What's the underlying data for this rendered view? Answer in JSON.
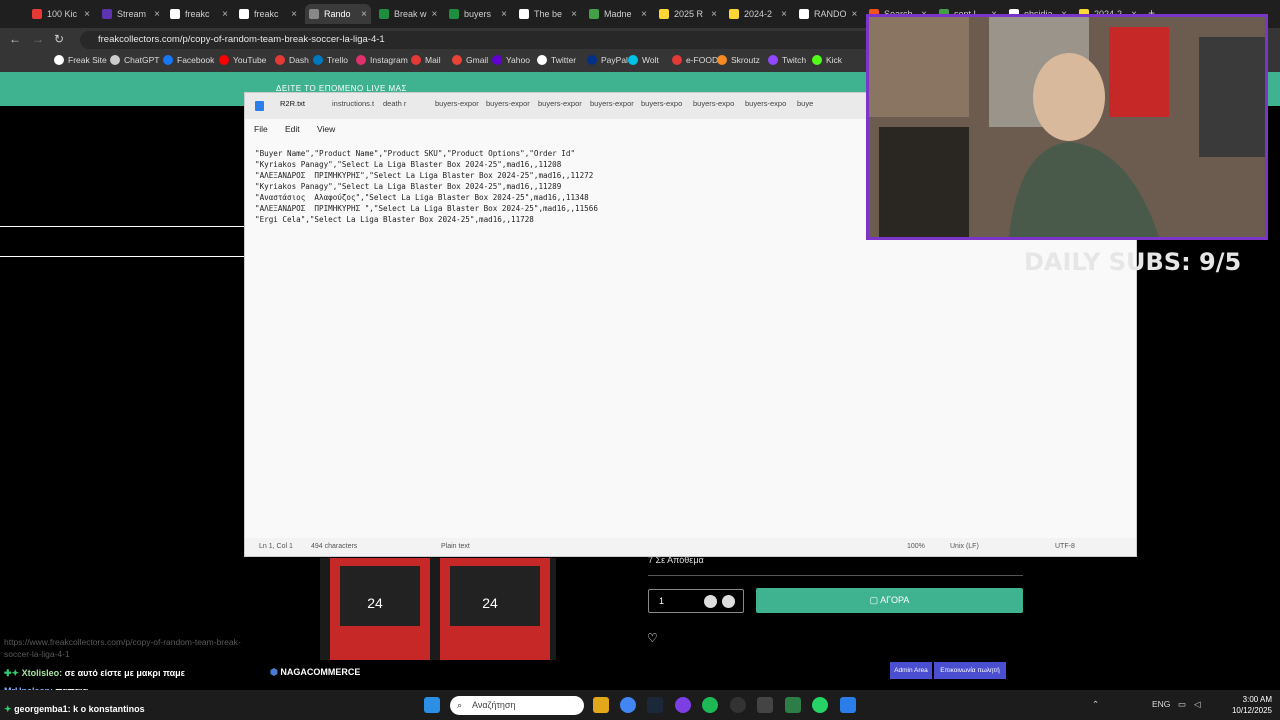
{
  "browser": {
    "tabs": [
      {
        "label": "100 Kic",
        "color": "#e53935"
      },
      {
        "label": "Stream",
        "color": "#5e35b1"
      },
      {
        "label": "freakc",
        "color": "#ffffff"
      },
      {
        "label": "freakc",
        "color": "#ffffff"
      },
      {
        "label": "Rando",
        "color": "#888888",
        "active": true
      },
      {
        "label": "Break w",
        "color": "#1e8e3e"
      },
      {
        "label": "buyers",
        "color": "#1e8e3e"
      },
      {
        "label": "The be",
        "color": "#ffffff"
      },
      {
        "label": "Madne",
        "color": "#43a047"
      },
      {
        "label": "2025 R",
        "color": "#fdd835"
      },
      {
        "label": "2024-2",
        "color": "#fdd835"
      },
      {
        "label": "RANDO",
        "color": "#ffffff"
      },
      {
        "label": "Search",
        "color": "#f4511e"
      },
      {
        "label": "sent L",
        "color": "#43a047"
      },
      {
        "label": "obsidia",
        "color": "#ffffff"
      },
      {
        "label": "2024-2",
        "color": "#fdd835"
      }
    ],
    "url": "freakcollectors.com/p/copy-of-random-team-break-soccer-la-liga-4-1",
    "bookmarks": [
      {
        "label": "Freak Site",
        "color": "#ffffff"
      },
      {
        "label": "ChatGPT",
        "color": "#cccccc"
      },
      {
        "label": "Facebook",
        "color": "#1877f2"
      },
      {
        "label": "YouTube",
        "color": "#ff0000"
      },
      {
        "label": "Dash",
        "color": "#e53935"
      },
      {
        "label": "Trello",
        "color": "#0079bf"
      },
      {
        "label": "Instagram",
        "color": "#e1306c"
      },
      {
        "label": "Mail",
        "color": "#e53935"
      },
      {
        "label": "Gmail",
        "color": "#ea4335"
      },
      {
        "label": "Yahoo",
        "color": "#6001d2"
      },
      {
        "label": "Twitter",
        "color": "#ffffff"
      },
      {
        "label": "PayPal",
        "color": "#003087"
      },
      {
        "label": "Wolt",
        "color": "#00c2e8"
      },
      {
        "label": "e-FOOD",
        "color": "#e53935"
      },
      {
        "label": "Skroutz",
        "color": "#f68b24"
      },
      {
        "label": "Twitch",
        "color": "#9146ff"
      },
      {
        "label": "Kick",
        "color": "#53fc18"
      }
    ]
  },
  "site": {
    "banner": "ΔΕΙΤΕ ΤΟ ΕΠΟΜΕΝΟ LIVE ΜΑΣ",
    "stock": "7 Σε Απόθεμα",
    "qty": "1",
    "buy_label": "ΑΓΟΡΑ",
    "footer_brand": "NAGACOMMERCE",
    "admin_area": "Admin Area",
    "contact_creator": "Επικοινωνία πωλητή",
    "chat_link": "https://www.freakcollectors.com/p/copy-of-random-team-break-soccer-la-liga-4-1"
  },
  "notepad": {
    "tabs": [
      "R2R.txt",
      "instructions.t",
      "death r",
      "buyers-expor",
      "buyers-expor",
      "buyers-expor",
      "buyers-expor",
      "buyers-expo",
      "buyers-expo",
      "buyers-expo",
      "buye"
    ],
    "menu": [
      "File",
      "Edit",
      "View"
    ],
    "lines": [
      "\"Buyer Name\",\"Product Name\",\"Product SKU\",\"Product Options\",\"Order Id\"",
      "\"Kyriakos Panagy\",\"Select La Liga Blaster Box 2024-25\",mad16,,11208",
      "\"ΑΛΕΞΑΝΔΡΟΣ  ΠΡΙΜΗΚΥΡΗΣ\",\"Select La Liga Blaster Box 2024-25\",mad16,,11272",
      "\"Kyriakos Panagy\",\"Select La Liga Blaster Box 2024-25\",mad16,,11289",
      "\"Αναστάσιος  Αλαφούζος\",\"Select La Liga Blaster Box 2024-25\",mad16,,11348",
      "\"ΑΛΕΞΑΝΔΡΟΣ  ΠΡΙΜΗΚΥΡΗΣ \",\"Select La Liga Blaster Box 2024-25\",mad16,,11566",
      "\"Ergi Cela\",\"Select La Liga Blaster Box 2024-25\",mad16,,11728"
    ],
    "status": {
      "position": "Ln 1, Col 1",
      "chars": "494 characters",
      "format": "Plain text",
      "zoom": "100%",
      "eol": "Unix (LF)",
      "encoding": "UTF-8"
    }
  },
  "overlay": {
    "daily_subs": "DAILY SUBS: 9/5",
    "chat": [
      {
        "user": "Xtolisleo:",
        "text": "σε αυτό είστε με μακρι παμε"
      },
      {
        "user": "MrUnclean:",
        "text": "παπαια"
      },
      {
        "user": "georgemba1:",
        "text": "k o konstantinos"
      }
    ]
  },
  "taskbar": {
    "search_placeholder": "Αναζήτηση",
    "lang": "ENG",
    "time": "3:00 AM",
    "date": "10/12/2025"
  }
}
